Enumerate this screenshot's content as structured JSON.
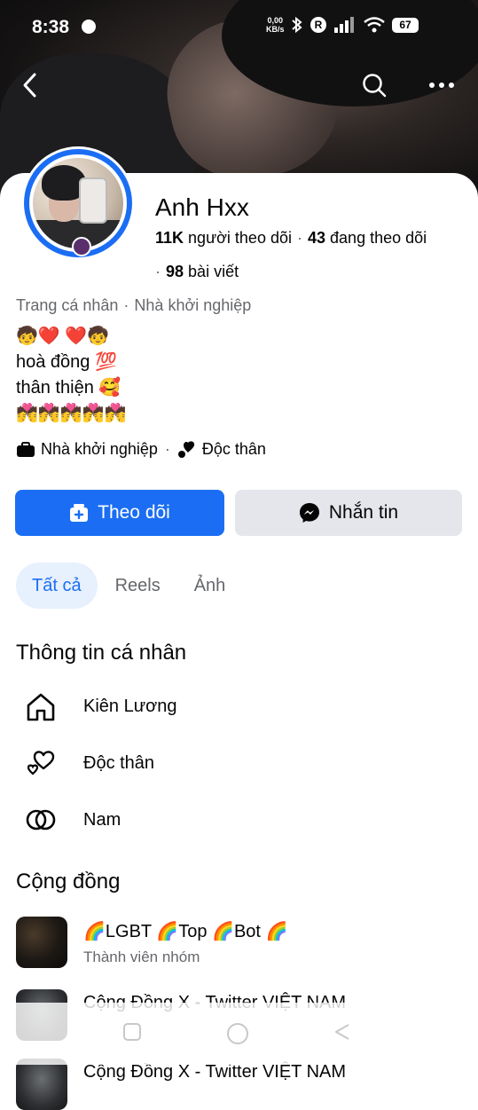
{
  "status_bar": {
    "time": "8:38",
    "net_speed_value": "0,00",
    "net_speed_unit": "KB/s",
    "r_badge": "R",
    "battery": "67"
  },
  "profile": {
    "name": "Anh Hxx",
    "followers_count": "11K",
    "followers_label": "người theo dõi",
    "following_count": "43",
    "following_label": "đang theo dõi",
    "posts_count": "98",
    "posts_label": "bài viết",
    "category_left": "Trang cá nhân",
    "category_right": "Nhà khởi nghiệp",
    "bio_lines": [
      "🧒❤️  ❤️🧒",
      "hoà đồng 💯",
      "thân thiện 🥰",
      "💏💏💏💏💏"
    ],
    "tag_job": "Nhà khởi nghiệp",
    "tag_relationship": "Độc thân"
  },
  "actions": {
    "follow_label": "Theo dõi",
    "message_label": "Nhắn tin"
  },
  "tabs": [
    {
      "label": "Tất cả",
      "active": true
    },
    {
      "label": "Reels",
      "active": false
    },
    {
      "label": "Ảnh",
      "active": false
    }
  ],
  "personal_info": {
    "title": "Thông tin cá nhân",
    "items": [
      {
        "icon": "home-icon",
        "text": "Kiên Lương"
      },
      {
        "icon": "hearts-icon",
        "text": "Độc thân"
      },
      {
        "icon": "gender-icon",
        "text": "Nam"
      }
    ]
  },
  "community": {
    "title": "Cộng đồng",
    "groups": [
      {
        "name": "🌈LGBT 🌈Top 🌈Bot 🌈",
        "sub": "Thành viên nhóm"
      },
      {
        "name": "Cộng Đồng X - Twitter VIỆT NAM",
        "sub": ""
      },
      {
        "name": "Cộng Đồng X - Twitter VIỆT NAM",
        "sub": ""
      }
    ]
  },
  "colors": {
    "accent": "#1b6ef3",
    "secondary_button": "#e4e6eb",
    "muted_text": "#65676b",
    "active_tab_bg": "#e7f0fd"
  }
}
